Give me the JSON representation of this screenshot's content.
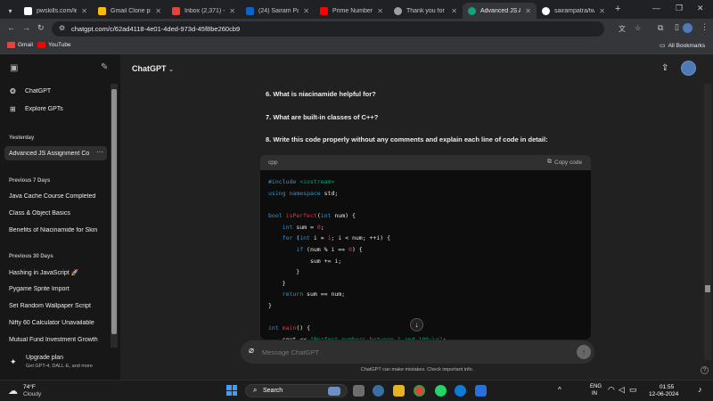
{
  "browser": {
    "tabs": [
      {
        "label": "pwskills.com/lea",
        "color": "#ffffff"
      },
      {
        "label": "Gmail Clone pro",
        "color": "#fbbc04"
      },
      {
        "label": "Inbox (2,371) - p",
        "color": "#ea4335"
      },
      {
        "label": "(24) Sairam Patra",
        "color": "#0a66c2"
      },
      {
        "label": "Prime Number P",
        "color": "#ff0000"
      },
      {
        "label": "Thank you for d",
        "color": "#9aa0a6"
      },
      {
        "label": "Advanced JS Ass",
        "color": "#10a37f"
      },
      {
        "label": "sairampatra/two",
        "color": "#ffffff"
      }
    ],
    "url": "chatgpt.com/c/62ad4118-4e01-4ded-973d-45f8be260cb9",
    "bookmarks": [
      {
        "label": "Gmail",
        "color": "#ea4335"
      },
      {
        "label": "YouTube",
        "color": "#ff0000"
      }
    ],
    "all_bookmarks": "All Bookmarks"
  },
  "sidebar": {
    "top_items": [
      "ChatGPT",
      "Explore GPTs"
    ],
    "sections": [
      {
        "heading": "Yesterday",
        "items": [
          "Advanced JS Assignment Co"
        ]
      },
      {
        "heading": "Previous 7 Days",
        "items": [
          "Java Cache Course Completed",
          "Class & Object Basics",
          "Benefits of Niacinamide for Skin"
        ]
      },
      {
        "heading": "Previous 30 Days",
        "items": [
          "Hashing in JavaScript 🚀",
          "Pygame Sprite Import",
          "Set Random Wallpaper Script",
          "Nifty 60 Calculator Unavailable",
          "Mutual Fund Investment Growth"
        ]
      }
    ],
    "more_icon": "···",
    "upgrade_title": "Upgrade plan",
    "upgrade_sub": "Get GPT-4, DALL·E, and more"
  },
  "header": {
    "model": "ChatGPT"
  },
  "questions": [
    "6.   What is niacinamide helpful for?",
    "7.   What are built-in classes of C++?",
    "8.   Write this code properly without any comments and explain each line of code in detail:"
  ],
  "code": {
    "lang": "cpp",
    "copy_label": "Copy code"
  },
  "composer": {
    "placeholder": "Message ChatGPT"
  },
  "footer_note": "ChatGPT can make mistakes. Check important info.",
  "taskbar": {
    "weather_temp": "74°F",
    "weather_desc": "Cloudy",
    "search_label": "Search",
    "lang_line1": "ENG",
    "lang_line2": "IN",
    "time": "01:55",
    "date": "12-06-2024"
  },
  "colors": {
    "accent": "#10a37f",
    "sidebar": "#171717",
    "main": "#212121"
  }
}
